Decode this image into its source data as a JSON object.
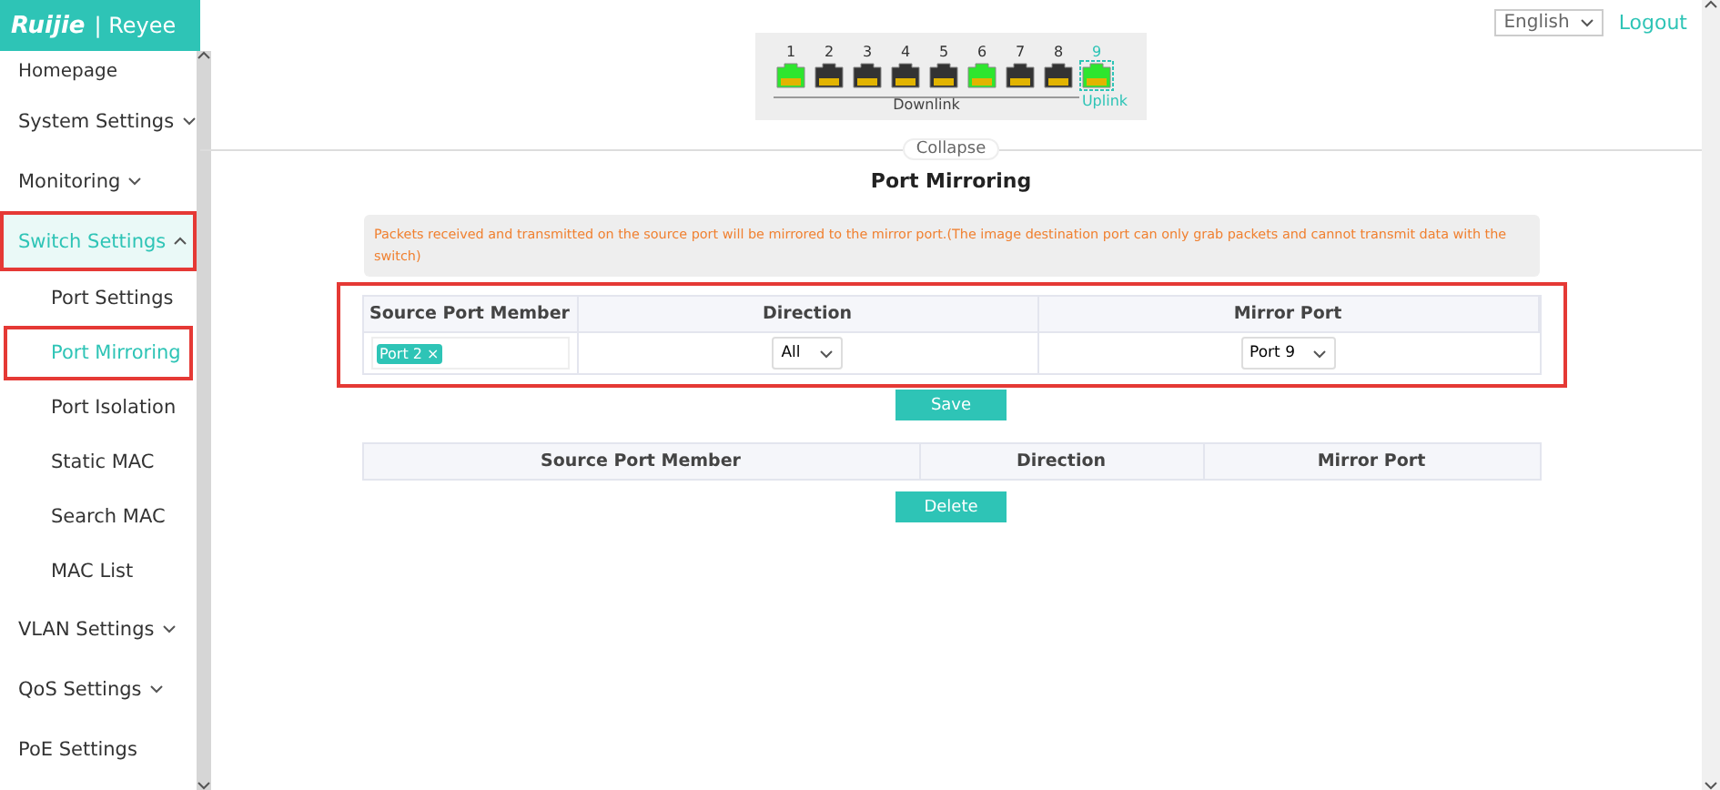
{
  "sidebar": {
    "logo": {
      "brand": "Ruijie",
      "separator": "|",
      "sub": "Reyee"
    },
    "items": [
      {
        "label": "Homepage",
        "expandable": false,
        "selected": false,
        "highlighted": false
      },
      {
        "label": "System Settings",
        "expandable": true,
        "expanded": false,
        "selected": false,
        "highlighted": false
      },
      {
        "label": "Monitoring",
        "expandable": true,
        "expanded": false,
        "selected": false,
        "highlighted": false
      },
      {
        "label": "Switch Settings",
        "expandable": true,
        "expanded": true,
        "selected": true,
        "highlighted": true,
        "children": [
          {
            "label": "Port Settings",
            "selected": false,
            "highlighted": false
          },
          {
            "label": "Port Mirroring",
            "selected": true,
            "highlighted": true
          },
          {
            "label": "Port Isolation",
            "selected": false,
            "highlighted": false
          },
          {
            "label": "Static MAC",
            "selected": false,
            "highlighted": false
          },
          {
            "label": "Search MAC",
            "selected": false,
            "highlighted": false
          },
          {
            "label": "MAC List",
            "selected": false,
            "highlighted": false
          }
        ]
      },
      {
        "label": "VLAN Settings",
        "expandable": true,
        "expanded": false,
        "selected": false,
        "highlighted": false
      },
      {
        "label": "QoS Settings",
        "expandable": true,
        "expanded": false,
        "selected": false,
        "highlighted": false
      },
      {
        "label": "PoE Settings",
        "expandable": false,
        "selected": false,
        "highlighted": false
      }
    ]
  },
  "header": {
    "language": "English",
    "logout": "Logout"
  },
  "ports": [
    {
      "number": "1",
      "kind": "downlink",
      "up": true
    },
    {
      "number": "2",
      "kind": "downlink",
      "up": false
    },
    {
      "number": "3",
      "kind": "downlink",
      "up": false
    },
    {
      "number": "4",
      "kind": "downlink",
      "up": false
    },
    {
      "number": "5",
      "kind": "downlink",
      "up": false
    },
    {
      "number": "6",
      "kind": "downlink",
      "up": true
    },
    {
      "number": "7",
      "kind": "downlink",
      "up": false
    },
    {
      "number": "8",
      "kind": "downlink",
      "up": false
    },
    {
      "number": "9",
      "kind": "uplink",
      "up": true
    }
  ],
  "port_groups": {
    "downlink": "Downlink",
    "uplink": "Uplink"
  },
  "collapse": "Collapse",
  "title": "Port Mirroring",
  "notice": "Packets received and transmitted on the source port will be mirrored to the mirror port.(The image destination port can only grab packets and cannot transmit data with the switch)",
  "form": {
    "highlighted": true,
    "columns": [
      "Source Port Member",
      "Direction",
      "Mirror Port"
    ],
    "source_tags": [
      "Port 2"
    ],
    "tag_remove": "×",
    "direction": "All",
    "mirror_port": "Port 9"
  },
  "save": "Save",
  "list": {
    "columns": [
      "Source Port Member",
      "Direction",
      "Mirror Port"
    ]
  },
  "delete": "Delete"
}
